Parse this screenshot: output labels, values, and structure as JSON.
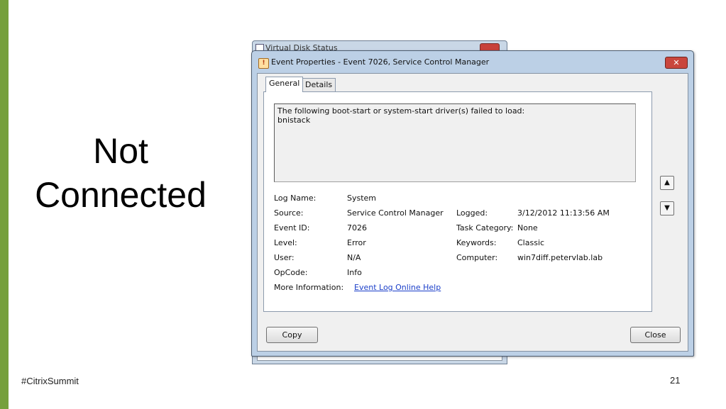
{
  "slide": {
    "title": "Not\nConnected",
    "hashtag": "#CitrixSummit",
    "page_number": "21",
    "accent_color": "#76a03c"
  },
  "background_window": {
    "title": "Virtual Disk Status"
  },
  "dialog": {
    "title": "Event Properties - Event 7026, Service Control Manager",
    "tabs": [
      {
        "label": "General",
        "active": true
      },
      {
        "label": "Details",
        "active": false
      }
    ],
    "description_line1": "The following boot-start or system-start driver(s) failed to load:",
    "description_line2": "bnistack",
    "fields": {
      "log_name_label": "Log Name:",
      "log_name_value": "System",
      "source_label": "Source:",
      "source_value": "Service Control Manager",
      "logged_label": "Logged:",
      "logged_value": "3/12/2012 11:13:56 AM",
      "event_id_label": "Event ID:",
      "event_id_value": "7026",
      "task_category_label": "Task Category:",
      "task_category_value": "None",
      "level_label": "Level:",
      "level_value": "Error",
      "keywords_label": "Keywords:",
      "keywords_value": "Classic",
      "user_label": "User:",
      "user_value": "N/A",
      "computer_label": "Computer:",
      "computer_value": "win7diff.petervlab.lab",
      "opcode_label": "OpCode:",
      "opcode_value": "Info",
      "more_info_label": "More Information:",
      "more_info_link": "Event Log Online Help"
    },
    "buttons": {
      "copy": "Copy",
      "close": "Close",
      "up_icon": "arrow-up-icon",
      "down_icon": "arrow-down-icon"
    }
  }
}
